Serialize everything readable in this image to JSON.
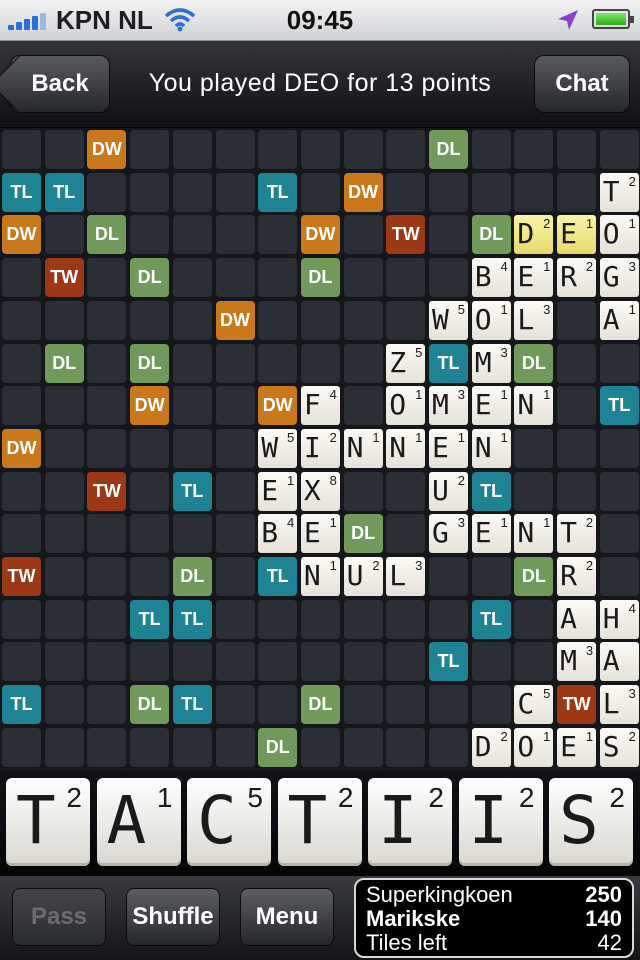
{
  "status_bar": {
    "carrier": "KPN NL",
    "time": "09:45"
  },
  "header": {
    "title": "You played DEO for 13 points",
    "back_label": "Back",
    "chat_label": "Chat"
  },
  "board": {
    "premiums": [
      {
        "r": 0,
        "c": 2,
        "t": "DW"
      },
      {
        "r": 0,
        "c": 10,
        "t": "DL"
      },
      {
        "r": 1,
        "c": 0,
        "t": "TL"
      },
      {
        "r": 1,
        "c": 1,
        "t": "TL"
      },
      {
        "r": 1,
        "c": 6,
        "t": "TL"
      },
      {
        "r": 1,
        "c": 8,
        "t": "DW"
      },
      {
        "r": 2,
        "c": 0,
        "t": "DW"
      },
      {
        "r": 2,
        "c": 2,
        "t": "DL"
      },
      {
        "r": 2,
        "c": 7,
        "t": "DW"
      },
      {
        "r": 2,
        "c": 9,
        "t": "TW"
      },
      {
        "r": 2,
        "c": 11,
        "t": "DL"
      },
      {
        "r": 3,
        "c": 1,
        "t": "TW"
      },
      {
        "r": 3,
        "c": 3,
        "t": "DL"
      },
      {
        "r": 3,
        "c": 7,
        "t": "DL"
      },
      {
        "r": 4,
        "c": 5,
        "t": "DW"
      },
      {
        "r": 5,
        "c": 1,
        "t": "DL"
      },
      {
        "r": 5,
        "c": 3,
        "t": "DL"
      },
      {
        "r": 5,
        "c": 10,
        "t": "TL"
      },
      {
        "r": 5,
        "c": 12,
        "t": "DL"
      },
      {
        "r": 6,
        "c": 3,
        "t": "DW"
      },
      {
        "r": 6,
        "c": 6,
        "t": "DW"
      },
      {
        "r": 6,
        "c": 14,
        "t": "TL"
      },
      {
        "r": 7,
        "c": 0,
        "t": "DW"
      },
      {
        "r": 8,
        "c": 2,
        "t": "TW"
      },
      {
        "r": 8,
        "c": 4,
        "t": "TL"
      },
      {
        "r": 8,
        "c": 11,
        "t": "TL"
      },
      {
        "r": 9,
        "c": 8,
        "t": "DL"
      },
      {
        "r": 10,
        "c": 0,
        "t": "TW"
      },
      {
        "r": 10,
        "c": 4,
        "t": "DL"
      },
      {
        "r": 10,
        "c": 6,
        "t": "TL"
      },
      {
        "r": 10,
        "c": 12,
        "t": "DL"
      },
      {
        "r": 11,
        "c": 3,
        "t": "TL"
      },
      {
        "r": 11,
        "c": 4,
        "t": "TL"
      },
      {
        "r": 11,
        "c": 11,
        "t": "TL"
      },
      {
        "r": 12,
        "c": 10,
        "t": "TL"
      },
      {
        "r": 13,
        "c": 0,
        "t": "TL"
      },
      {
        "r": 13,
        "c": 3,
        "t": "DL"
      },
      {
        "r": 13,
        "c": 4,
        "t": "TL"
      },
      {
        "r": 13,
        "c": 7,
        "t": "DL"
      },
      {
        "r": 13,
        "c": 13,
        "t": "TW"
      },
      {
        "r": 14,
        "c": 6,
        "t": "DL"
      }
    ],
    "tiles": [
      {
        "r": 1,
        "c": 14,
        "l": "T",
        "v": "2"
      },
      {
        "r": 2,
        "c": 12,
        "l": "D",
        "v": "2",
        "new": true
      },
      {
        "r": 2,
        "c": 13,
        "l": "E",
        "v": "1",
        "new": true
      },
      {
        "r": 2,
        "c": 14,
        "l": "O",
        "v": "1"
      },
      {
        "r": 3,
        "c": 11,
        "l": "B",
        "v": "4"
      },
      {
        "r": 3,
        "c": 12,
        "l": "E",
        "v": "1"
      },
      {
        "r": 3,
        "c": 13,
        "l": "R",
        "v": "2"
      },
      {
        "r": 3,
        "c": 14,
        "l": "G",
        "v": "3"
      },
      {
        "r": 4,
        "c": 10,
        "l": "W",
        "v": "5"
      },
      {
        "r": 4,
        "c": 11,
        "l": "O",
        "v": "1"
      },
      {
        "r": 4,
        "c": 12,
        "l": "L",
        "v": "3"
      },
      {
        "r": 4,
        "c": 14,
        "l": "A",
        "v": "1"
      },
      {
        "r": 5,
        "c": 9,
        "l": "Z",
        "v": "5"
      },
      {
        "r": 5,
        "c": 11,
        "l": "M",
        "v": "3"
      },
      {
        "r": 6,
        "c": 7,
        "l": "F",
        "v": "4"
      },
      {
        "r": 6,
        "c": 9,
        "l": "O",
        "v": "1"
      },
      {
        "r": 6,
        "c": 10,
        "l": "M",
        "v": "3"
      },
      {
        "r": 6,
        "c": 11,
        "l": "E",
        "v": "1"
      },
      {
        "r": 6,
        "c": 12,
        "l": "N",
        "v": "1"
      },
      {
        "r": 7,
        "c": 6,
        "l": "W",
        "v": "5"
      },
      {
        "r": 7,
        "c": 7,
        "l": "I",
        "v": "2"
      },
      {
        "r": 7,
        "c": 8,
        "l": "N",
        "v": "1"
      },
      {
        "r": 7,
        "c": 9,
        "l": "N",
        "v": "1"
      },
      {
        "r": 7,
        "c": 10,
        "l": "E",
        "v": "1"
      },
      {
        "r": 7,
        "c": 11,
        "l": "N",
        "v": "1"
      },
      {
        "r": 8,
        "c": 6,
        "l": "E",
        "v": "1"
      },
      {
        "r": 8,
        "c": 7,
        "l": "X",
        "v": "8"
      },
      {
        "r": 8,
        "c": 10,
        "l": "U",
        "v": "2"
      },
      {
        "r": 9,
        "c": 6,
        "l": "B",
        "v": "4"
      },
      {
        "r": 9,
        "c": 7,
        "l": "E",
        "v": "1"
      },
      {
        "r": 9,
        "c": 10,
        "l": "G",
        "v": "3"
      },
      {
        "r": 9,
        "c": 11,
        "l": "E",
        "v": "1"
      },
      {
        "r": 9,
        "c": 12,
        "l": "N",
        "v": "1"
      },
      {
        "r": 9,
        "c": 13,
        "l": "T",
        "v": "2"
      },
      {
        "r": 10,
        "c": 7,
        "l": "N",
        "v": "1"
      },
      {
        "r": 10,
        "c": 8,
        "l": "U",
        "v": "2"
      },
      {
        "r": 10,
        "c": 9,
        "l": "L",
        "v": "3"
      },
      {
        "r": 10,
        "c": 13,
        "l": "R",
        "v": "2"
      },
      {
        "r": 11,
        "c": 13,
        "l": "A",
        "v": ""
      },
      {
        "r": 11,
        "c": 14,
        "l": "H",
        "v": "4"
      },
      {
        "r": 12,
        "c": 13,
        "l": "M",
        "v": "3"
      },
      {
        "r": 12,
        "c": 14,
        "l": "A",
        "v": ""
      },
      {
        "r": 13,
        "c": 12,
        "l": "C",
        "v": "5"
      },
      {
        "r": 13,
        "c": 14,
        "l": "L",
        "v": "3"
      },
      {
        "r": 14,
        "c": 11,
        "l": "D",
        "v": "2"
      },
      {
        "r": 14,
        "c": 12,
        "l": "O",
        "v": "1"
      },
      {
        "r": 14,
        "c": 13,
        "l": "E",
        "v": "1"
      },
      {
        "r": 14,
        "c": 14,
        "l": "S",
        "v": "2"
      }
    ]
  },
  "rack": [
    {
      "l": "T",
      "v": "2"
    },
    {
      "l": "A",
      "v": "1"
    },
    {
      "l": "C",
      "v": "5"
    },
    {
      "l": "T",
      "v": "2"
    },
    {
      "l": "I",
      "v": "2"
    },
    {
      "l": "I",
      "v": "2"
    },
    {
      "l": "S",
      "v": "2"
    }
  ],
  "bottom": {
    "pass_label": "Pass",
    "shuffle_label": "Shuffle",
    "menu_label": "Menu",
    "scores": [
      {
        "name": "Superkingkoen",
        "score": "250"
      },
      {
        "name": "Marikske",
        "score": "140"
      }
    ],
    "tiles_left_label": "Tiles left",
    "tiles_left": "42"
  },
  "colors": {
    "DW": "#c9781b",
    "TW": "#9c3816",
    "DL": "#6f9a5a",
    "TL": "#1f8396",
    "board_cell": "#2c2e35"
  },
  "icons": [
    "signal-bars-icon",
    "wifi-icon",
    "location-arrow-icon",
    "battery-icon"
  ]
}
